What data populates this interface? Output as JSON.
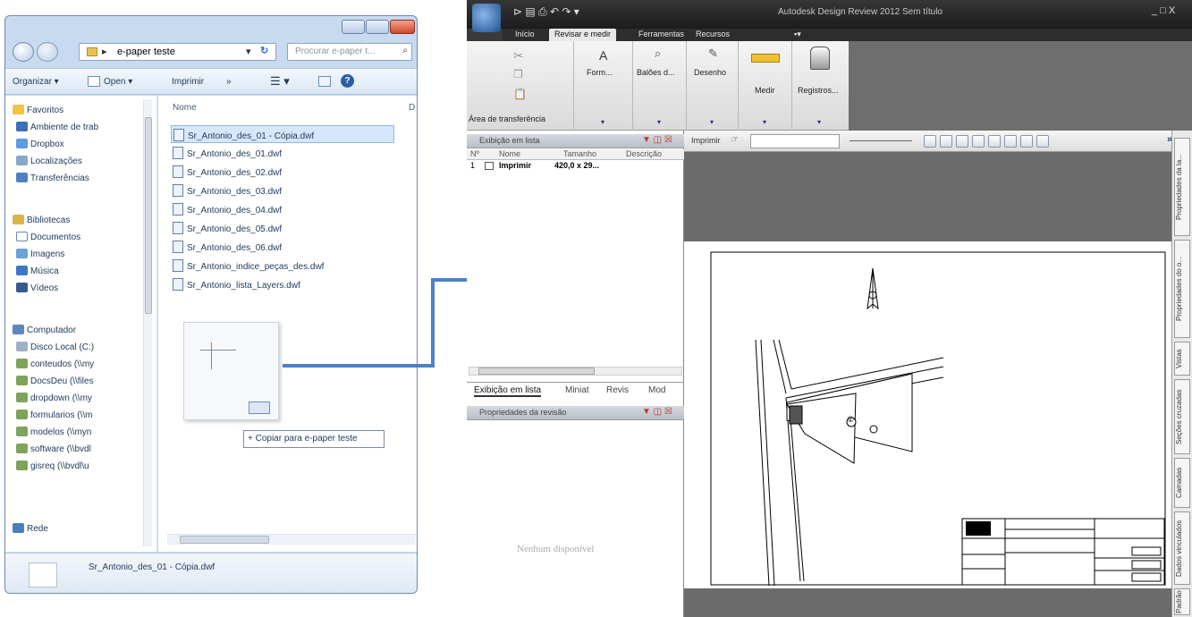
{
  "explorer": {
    "breadcrumb": "e-paper teste",
    "search_placeholder": "Procurar e-paper t...",
    "toolbar": {
      "organize": "Organizar",
      "open": "Open",
      "print": "Imprimir",
      "more": "»"
    },
    "column_name": "Nome",
    "column_d": "D",
    "nav": {
      "favorites": "Favoritos",
      "favorites_items": [
        "Ambiente de trab",
        "Dropbox",
        "Localizações",
        "Transferências"
      ],
      "libraries": "Bibliotecas",
      "libraries_items": [
        "Documentos",
        "Imagens",
        "Música",
        "Vídeos"
      ],
      "computer": "Computador",
      "computer_items": [
        "Disco Local (C:)",
        "conteudos (\\\\my",
        "DocsDeu (\\\\files",
        "dropdown (\\\\my",
        "formularios (\\\\m",
        "modelos (\\\\myn",
        "software (\\\\bvdl",
        "gisreq (\\\\bvdl\\u"
      ],
      "network": "Rede"
    },
    "files": [
      "Sr_Antonio_des_01 - Cópia.dwf",
      "Sr_Antonio_des_01.dwf",
      "Sr_Antonio_des_02.dwf",
      "Sr_Antonio_des_03.dwf",
      "Sr_Antonio_des_04.dwf",
      "Sr_Antonio_des_05.dwf",
      "Sr_Antonio_des_06.dwf",
      "Sr_Antonio_indice_peças_des.dwf",
      "Sr_Antonio_lista_Layers.dwf"
    ],
    "drag_tooltip": "+ Copiar para e-paper teste",
    "details_filename": "Sr_Antonio_des_01 - Cópia.dwf"
  },
  "design_review": {
    "title": "Autodesk Design Review 2012   Sem título",
    "window_controls": "_ □ X",
    "tabs": [
      "Início",
      "Revisar e medir",
      "Ferramentas",
      "Recursos"
    ],
    "ribbon": {
      "clipboard": "Área de transferência",
      "format": "Form...",
      "balloons": "Balões d...",
      "drawing": "Desenho",
      "measure": "Medir",
      "records": "Registros..."
    },
    "list_pane_title": "Exibição em lista",
    "list_columns": [
      "Nº",
      "Nome",
      "Tamanho",
      "Descrição"
    ],
    "list_row": {
      "num": "1",
      "name": "Imprimir",
      "size": "420,0 x 29..."
    },
    "bottom_tabs": [
      "Exibição em lista",
      "Miniat",
      "Revis",
      "Mod"
    ],
    "props_pane_title": "Propriedades da revisão",
    "props_empty": "Nenhum disponível",
    "toolbar_print": "Imprimir",
    "side_tabs": [
      "Propriedades da la...",
      "Propriedades do o...",
      "Vistas",
      "Seções cruzadas",
      "Camadas",
      "Dados vinculados",
      "Padrão"
    ],
    "sheet_circle_label": "①"
  },
  "colors": {
    "arrow": "#4d80c9",
    "explorer_frame": "#c7daf0",
    "dr_dark": "#3a3a3a"
  }
}
